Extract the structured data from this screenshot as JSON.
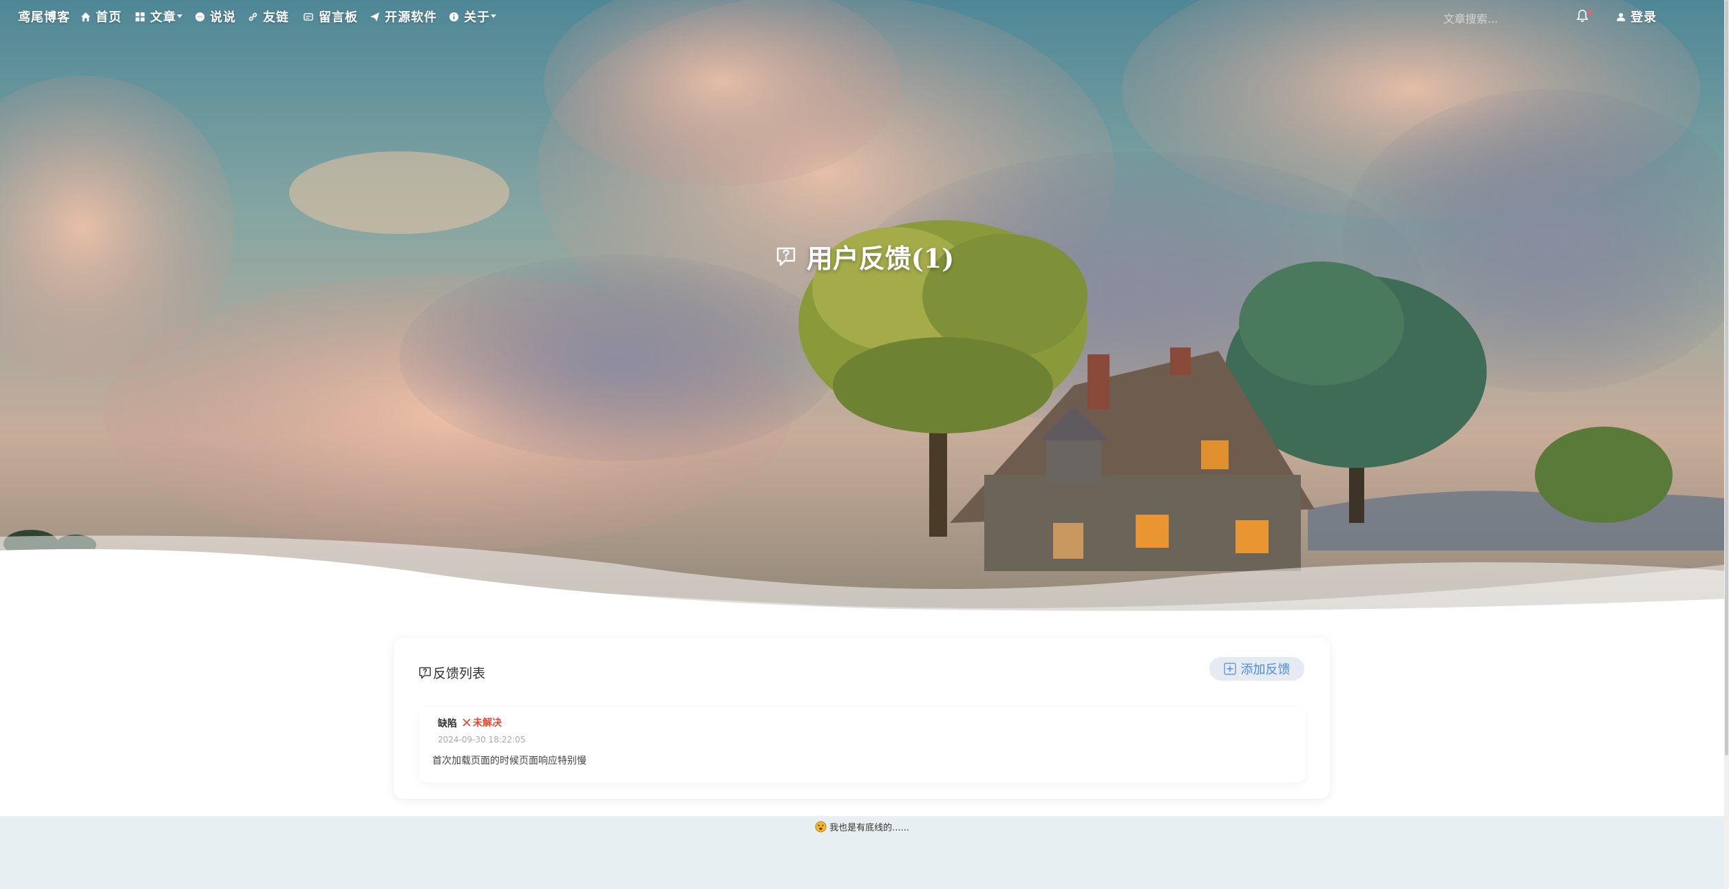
{
  "nav": {
    "brand": "鸢尾博客",
    "items": [
      {
        "label": "首页",
        "icon": "home-icon"
      },
      {
        "label": "文章",
        "icon": "grid-icon"
      },
      {
        "label": "说说",
        "icon": "chat-bubble-icon"
      },
      {
        "label": "友链",
        "icon": "link-icon"
      },
      {
        "label": "留言板",
        "icon": "message-board-icon"
      },
      {
        "label": "开源软件",
        "icon": "paper-plane-icon"
      },
      {
        "label": "关于",
        "icon": "info-icon"
      }
    ],
    "search_placeholder": "文章搜索...",
    "login_label": "登录"
  },
  "hero": {
    "title": "用户反馈(1)",
    "icon": "feedback-question-icon"
  },
  "feedback": {
    "list_title": "反馈列表",
    "add_label": "添加反馈",
    "items": [
      {
        "type": "缺陷",
        "status": "未解决",
        "date": "2024-09-30 18:22:05",
        "content": "首次加载页面的时候页面响应特别慢"
      }
    ]
  },
  "footer": {
    "text": "我也是有底线的......"
  },
  "colors": {
    "accent": "#4a8cdc",
    "status_unresolved": "#f0442e",
    "footer_bg": "#e8eff2"
  }
}
